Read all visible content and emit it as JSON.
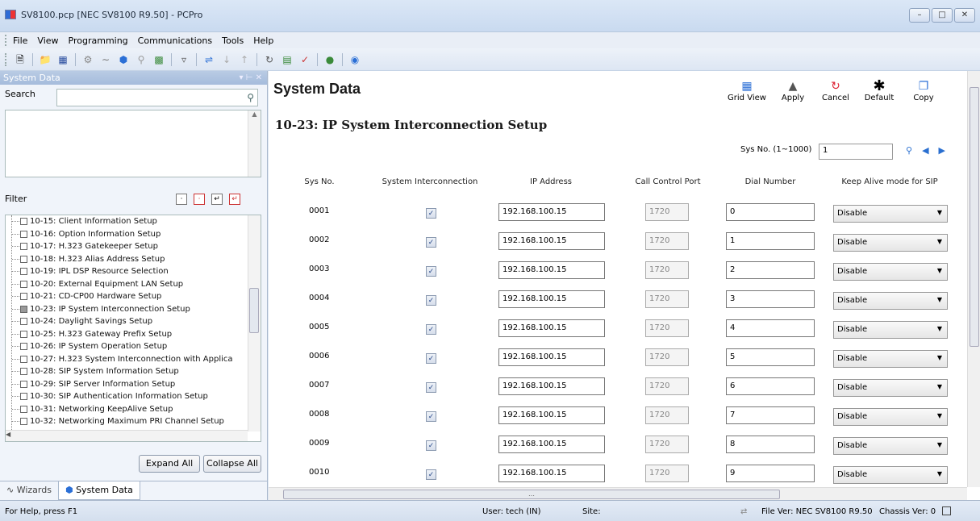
{
  "window": {
    "title": "SV8100.pcp [NEC SV8100 R9.50] - PCPro"
  },
  "menu": {
    "items": [
      "File",
      "View",
      "Programming",
      "Communications",
      "Tools",
      "Help"
    ]
  },
  "left": {
    "panel_title": "System Data",
    "search_label": "Search",
    "filter_label": "Filter",
    "expand_all": "Expand All",
    "collapse_all": "Collapse All",
    "tree_items": [
      "10-15: Client Information Setup",
      "10-16: Option Information Setup",
      "10-17: H.323 Gatekeeper Setup",
      "10-18: H.323 Alias Address Setup",
      "10-19: IPL DSP Resource Selection",
      "10-20: External Equipment LAN Setup",
      "10-21: CD-CP00 Hardware Setup",
      "10-23: IP System Interconnection Setup",
      "10-24: Daylight Savings Setup",
      "10-25: H.323 Gateway Prefix Setup",
      "10-26: IP System Operation Setup",
      "10-27: H.323 System Interconnection with Applica",
      "10-28: SIP System Information Setup",
      "10-29: SIP Server Information Setup",
      "10-30: SIP Authentication Information Setup",
      "10-31: Networking KeepAlive Setup",
      "10-32: Networking Maximum PRI Channel Setup"
    ],
    "selected_index": 7,
    "tabs": [
      "Wizards",
      "System Data"
    ]
  },
  "main": {
    "title": "System Data",
    "actions": [
      {
        "label": "Grid View",
        "icon": "grid-icon"
      },
      {
        "label": "Apply",
        "icon": "apply-icon"
      },
      {
        "label": "Cancel",
        "icon": "cancel-icon"
      },
      {
        "label": "Default",
        "icon": "default-icon"
      },
      {
        "label": "Copy",
        "icon": "copy-icon"
      }
    ],
    "section": "10-23: IP System Interconnection Setup",
    "sysno_label": "Sys No. (1~1000)",
    "sysno_value": "1",
    "columns": [
      "Sys No.",
      "System Interconnection",
      "IP Address",
      "Call Control Port",
      "Dial Number",
      "Keep Alive mode for SIP"
    ],
    "rows": [
      {
        "no": "0001",
        "checked": true,
        "ip": "192.168.100.15",
        "port": "1720",
        "dial": "0",
        "ka": "Disable"
      },
      {
        "no": "0002",
        "checked": true,
        "ip": "192.168.100.15",
        "port": "1720",
        "dial": "1",
        "ka": "Disable"
      },
      {
        "no": "0003",
        "checked": true,
        "ip": "192.168.100.15",
        "port": "1720",
        "dial": "2",
        "ka": "Disable"
      },
      {
        "no": "0004",
        "checked": true,
        "ip": "192.168.100.15",
        "port": "1720",
        "dial": "3",
        "ka": "Disable"
      },
      {
        "no": "0005",
        "checked": true,
        "ip": "192.168.100.15",
        "port": "1720",
        "dial": "4",
        "ka": "Disable"
      },
      {
        "no": "0006",
        "checked": true,
        "ip": "192.168.100.15",
        "port": "1720",
        "dial": "5",
        "ka": "Disable"
      },
      {
        "no": "0007",
        "checked": true,
        "ip": "192.168.100.15",
        "port": "1720",
        "dial": "6",
        "ka": "Disable"
      },
      {
        "no": "0008",
        "checked": true,
        "ip": "192.168.100.15",
        "port": "1720",
        "dial": "7",
        "ka": "Disable"
      },
      {
        "no": "0009",
        "checked": true,
        "ip": "192.168.100.15",
        "port": "1720",
        "dial": "8",
        "ka": "Disable"
      },
      {
        "no": "0010",
        "checked": true,
        "ip": "192.168.100.15",
        "port": "1720",
        "dial": "9",
        "ka": "Disable"
      }
    ]
  },
  "status": {
    "help": "For Help, press F1",
    "user": "User: tech (IN)",
    "site": "Site:",
    "file_ver": "File Ver: NEC SV8100 R9.50",
    "chassis_ver": "Chassis Ver: 0"
  },
  "colors": {
    "panel_header": "#a5bcdc",
    "background": "#dfe8f4",
    "accent": "#2a6fd0"
  }
}
